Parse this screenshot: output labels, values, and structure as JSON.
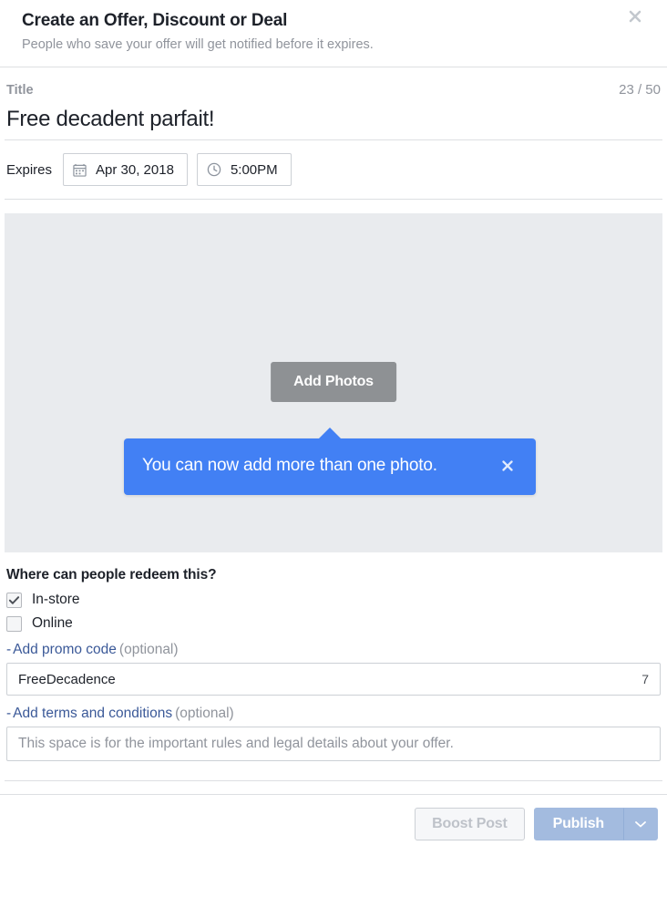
{
  "header": {
    "title": "Create an Offer, Discount or Deal",
    "subtitle": "People who save your offer will get notified before it expires.",
    "close_icon": "close-icon"
  },
  "title_field": {
    "label": "Title",
    "counter": "23 / 50",
    "value": "Free decadent parfait!"
  },
  "expires": {
    "label": "Expires",
    "date_icon": "calendar-icon",
    "date_value": "Apr 30, 2018",
    "time_icon": "clock-icon",
    "time_value": "5:00PM"
  },
  "photo": {
    "add_photos_label": "Add Photos",
    "tooltip_text": "You can now add more than one photo.",
    "tooltip_close_icon": "close-icon",
    "background_color": "#e9ebee",
    "tooltip_color": "#4280f4",
    "button_color": "#8e9194"
  },
  "redeem": {
    "heading": "Where can people redeem this?",
    "options": [
      {
        "label": "In-store",
        "checked": true
      },
      {
        "label": "Online",
        "checked": false
      }
    ]
  },
  "promo": {
    "toggle_sign": "-",
    "link_label": "Add promo code",
    "optional_label": "(optional)",
    "value": "FreeDecadence",
    "counter": "7"
  },
  "terms": {
    "toggle_sign": "-",
    "link_label": "Add terms and conditions",
    "optional_label": "(optional)",
    "placeholder": "This space is for the important rules and legal details about your offer."
  },
  "footer": {
    "boost_label": "Boost Post",
    "publish_label": "Publish",
    "caret_icon": "chevron-down-icon",
    "publish_color": "#a3bbdf"
  }
}
